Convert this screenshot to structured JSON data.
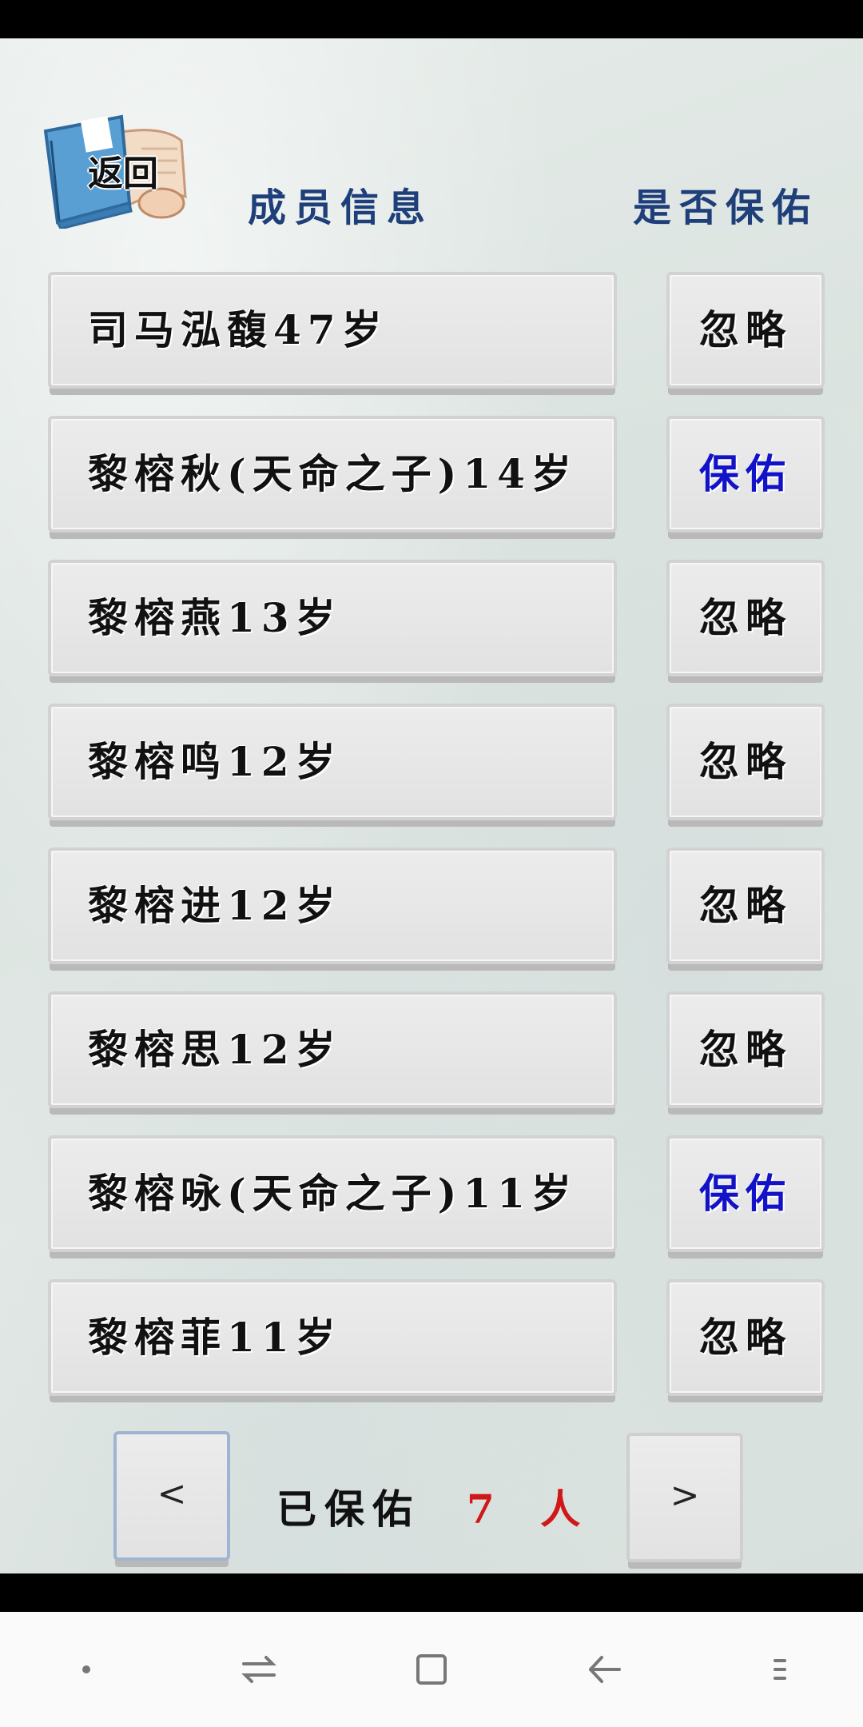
{
  "header": {
    "back_label": "返回",
    "col_members": "成员信息",
    "col_bless": "是否保佑"
  },
  "members": [
    {
      "name": "司马泓馥47岁",
      "action": "忽略",
      "status": "ignore"
    },
    {
      "name": "黎榕秋(天命之子)14岁",
      "action": "保佑",
      "status": "bless"
    },
    {
      "name": "黎榕燕13岁",
      "action": "忽略",
      "status": "ignore"
    },
    {
      "name": "黎榕鸣12岁",
      "action": "忽略",
      "status": "ignore"
    },
    {
      "name": "黎榕进12岁",
      "action": "忽略",
      "status": "ignore"
    },
    {
      "name": "黎榕思12岁",
      "action": "忽略",
      "status": "ignore"
    },
    {
      "name": "黎榕咏(天命之子)11岁",
      "action": "保佑",
      "status": "bless"
    },
    {
      "name": "黎榕菲11岁",
      "action": "忽略",
      "status": "ignore"
    }
  ],
  "footer": {
    "prev_label": "<",
    "next_label": ">",
    "blessed_label": "已保佑",
    "blessed_count": "7 人"
  },
  "colors": {
    "bless_text": "#1212c8",
    "count_text": "#d01818",
    "header_text": "#1f3f7a"
  },
  "navbar": {
    "icons": [
      "dot-icon",
      "switch-icon",
      "square-icon",
      "back-arrow-icon",
      "menu-icon"
    ]
  }
}
